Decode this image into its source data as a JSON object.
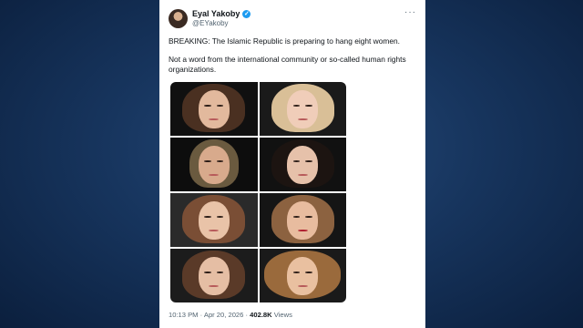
{
  "tweet": {
    "author_name": "Eyal Yakoby",
    "handle": "@EYakoby",
    "verified_icon": "verified-badge-icon",
    "more_icon": "more-icon",
    "more_glyph": "···",
    "paragraph_1": "BREAKING: The Islamic Republic is preparing to hang eight women.",
    "paragraph_2": "Not a word from the international community or so-called human rights organizations.",
    "image_count": 8,
    "time": "10:13 PM",
    "separator": "·",
    "date": "Apr 20, 2026",
    "views_count": "402.8K",
    "views_label": "Views"
  },
  "colors": {
    "background": "#17355e",
    "card": "#ffffff",
    "text": "#0f1419",
    "secondary": "#536471",
    "accent": "#1d9bf0"
  }
}
